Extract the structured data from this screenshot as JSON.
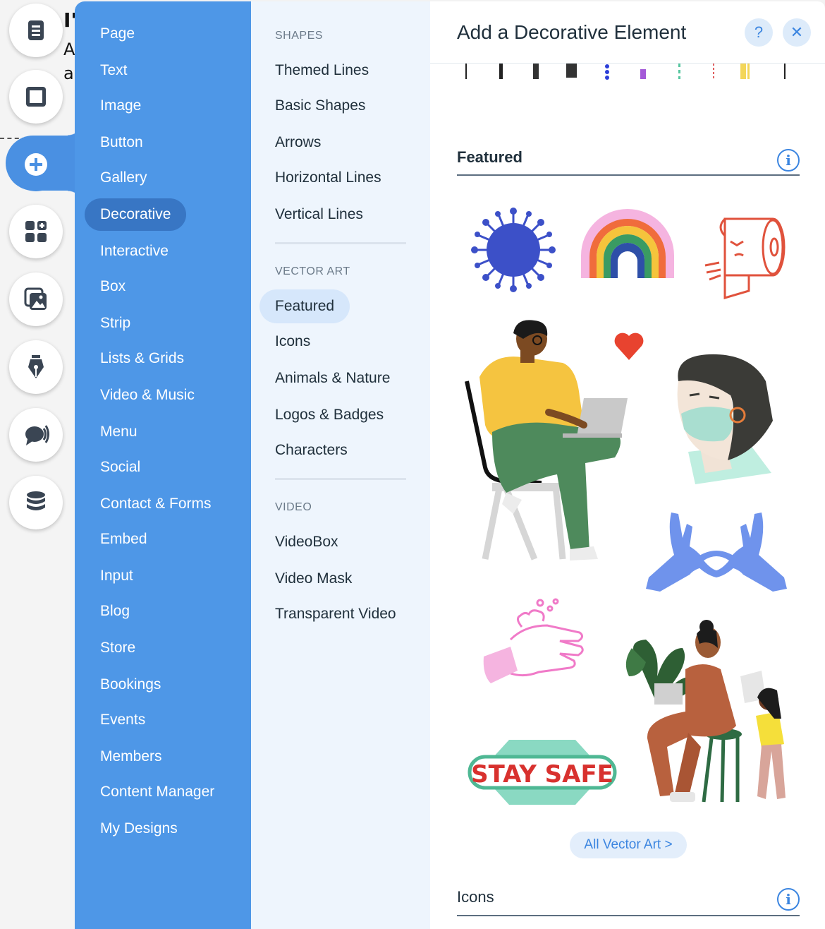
{
  "canvas": {
    "snippet_1": "I'",
    "snippet_2": "A",
    "snippet_3": "a"
  },
  "rail": {
    "items": [
      "pages-icon",
      "frame-icon",
      "add-icon",
      "apps-icon",
      "media-icon",
      "pen-icon",
      "chat-icon",
      "database-icon"
    ],
    "active": "add-icon",
    "accent": "#4a90e2"
  },
  "categories": [
    "Page",
    "Text",
    "Image",
    "Button",
    "Gallery",
    "Decorative",
    "Interactive",
    "Box",
    "Strip",
    "Lists & Grids",
    "Video & Music",
    "Menu",
    "Social",
    "Contact & Forms",
    "Embed",
    "Input",
    "Blog",
    "Store",
    "Bookings",
    "Events",
    "Members",
    "Content Manager",
    "My Designs"
  ],
  "active_category": "Decorative",
  "subpanel": {
    "shapes_heading": "SHAPES",
    "shapes": [
      "Themed Lines",
      "Basic Shapes",
      "Arrows",
      "Horizontal Lines",
      "Vertical Lines"
    ],
    "vector_heading": "VECTOR ART",
    "vector": [
      "Featured",
      "Icons",
      "Animals & Nature",
      "Logos & Badges",
      "Characters"
    ],
    "video_heading": "VIDEO",
    "video": [
      "VideoBox",
      "Video Mask",
      "Transparent Video"
    ],
    "active": "Featured"
  },
  "content": {
    "title": "Add a Decorative Element",
    "help_label": "?",
    "close_label": "✕",
    "featured_title": "Featured",
    "stay_safe_text": "STAY SAFE",
    "all_vector_label": "All Vector Art >",
    "icons_title": "Icons",
    "info_label": "i"
  },
  "colors": {
    "category_bg": "#4e97e7",
    "category_active": "#3876c4",
    "sub_bg": "#eef5fd",
    "link_blue": "#3b85e0"
  }
}
